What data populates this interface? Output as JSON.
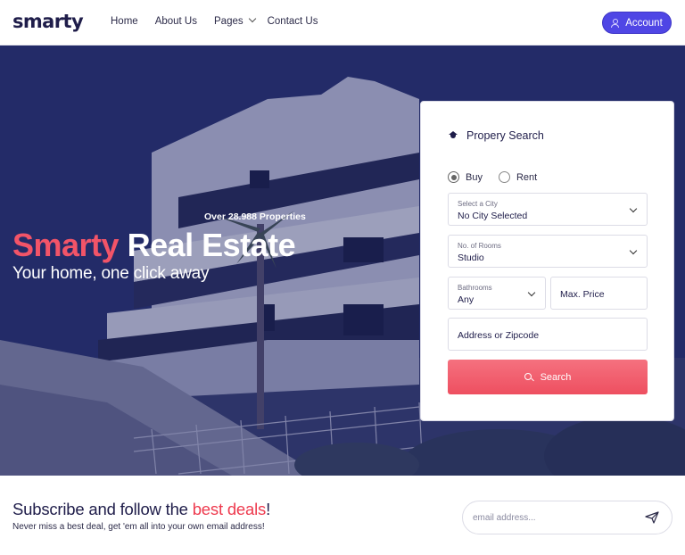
{
  "brand": {
    "logo": "smarty"
  },
  "nav": {
    "items": [
      "Home",
      "About Us",
      "Pages",
      "Contact Us"
    ],
    "account_label": "Account"
  },
  "hero": {
    "over_text": "Over 28.988 Properties",
    "title_accent": "Smarty",
    "title_rest": " Real Estate",
    "subtitle": "Your home, one click away"
  },
  "search": {
    "title": "Propery Search",
    "radio_buy": "Buy",
    "radio_rent": "Rent",
    "selected": "Buy",
    "city_label": "Select a City",
    "city_value": "No City Selected",
    "rooms_label": "No. of Rooms",
    "rooms_value": "Studio",
    "bath_label": "Bathrooms",
    "bath_value": "Any",
    "max_price_placeholder": "Max. Price",
    "address_placeholder": "Address or Zipcode",
    "search_label": "Search"
  },
  "subscribe": {
    "title_start": "Subscribe and follow the ",
    "title_accent": "best deals",
    "title_end": "!",
    "text": "Never miss a best deal, get 'em all into your own email address!",
    "email_placeholder": "email address..."
  },
  "colors": {
    "brand_navy": "#1f1d4a",
    "account_purple": "#4f46e5",
    "accent_red": "#ee3b4f",
    "hero_overlay": "#1c2760"
  }
}
